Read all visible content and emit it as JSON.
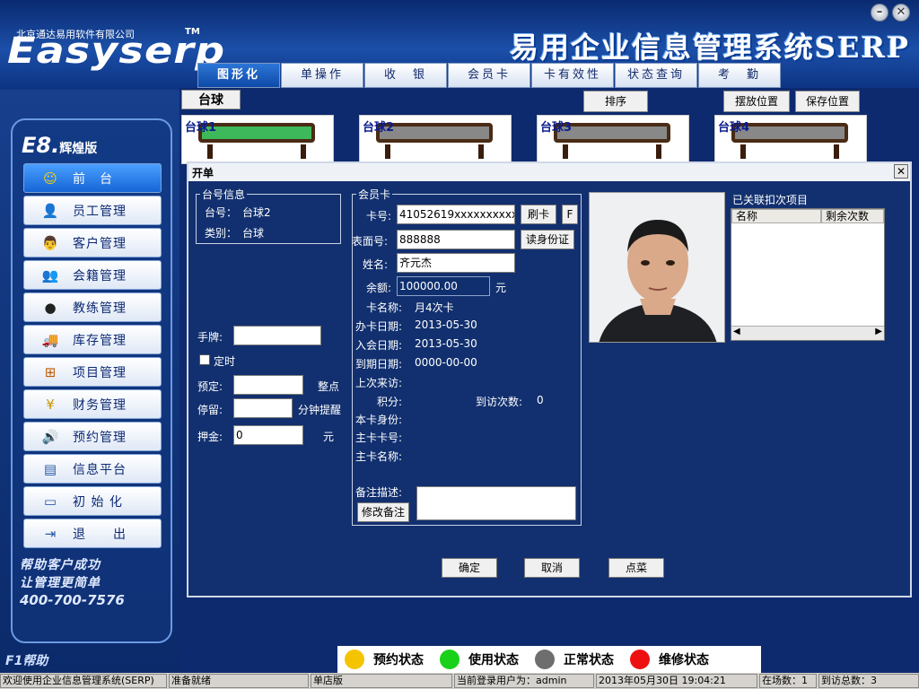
{
  "header": {
    "company": "北京通达易用软件有限公司",
    "logo": "Easyserp",
    "tm": "TM",
    "system_title": "易用企业信息管理系统SERP",
    "min_label": "–",
    "close_label": "✕"
  },
  "tabs": [
    "图形化",
    "单操作",
    "收　银",
    "会员卡",
    "卡有效性",
    "状态查询",
    "考　勤"
  ],
  "sidebar": {
    "edition_main": "E8.",
    "edition_sub": "辉煌版",
    "items": [
      {
        "label": "前　台",
        "icon": "smiley-icon",
        "glyph": "☺"
      },
      {
        "label": "员工管理",
        "icon": "user-icon",
        "glyph": "👤"
      },
      {
        "label": "客户管理",
        "icon": "customer-icon",
        "glyph": "👨"
      },
      {
        "label": "会籍管理",
        "icon": "membership-icon",
        "glyph": "👥"
      },
      {
        "label": "教练管理",
        "icon": "coach-icon",
        "glyph": "●"
      },
      {
        "label": "库存管理",
        "icon": "truck-icon",
        "glyph": "🚚"
      },
      {
        "label": "项目管理",
        "icon": "hierarchy-icon",
        "glyph": "⊞"
      },
      {
        "label": "财务管理",
        "icon": "coins-icon",
        "glyph": "¥"
      },
      {
        "label": "预约管理",
        "icon": "speaker-icon",
        "glyph": "🔊"
      },
      {
        "label": "信息平台",
        "icon": "info-platform-icon",
        "glyph": "▤"
      },
      {
        "label": "初 始 化",
        "icon": "monitor-icon",
        "glyph": "▭"
      },
      {
        "label": "退　　出",
        "icon": "exit-icon",
        "glyph": "⇥"
      }
    ],
    "slogan_line1": "帮助客户成功",
    "slogan_line2": "让管理更简单",
    "hotline": "400-700-7576",
    "help": "F1帮助"
  },
  "main": {
    "category": "台球",
    "sort_button": "排序",
    "place_button": "摆放位置",
    "save_button": "保存位置",
    "tables": [
      "台球1",
      "台球2",
      "台球3",
      "台球4"
    ]
  },
  "dialog": {
    "title": "开单",
    "close": "✕",
    "table_info": {
      "legend": "台号信息",
      "number_label": "台号：",
      "number_value": "台球2",
      "type_label": "类别：",
      "type_value": "台球"
    },
    "left_form": {
      "wristband_label": "手牌:",
      "wristband_value": "",
      "timer_label": "定时",
      "reserve_label": "预定:",
      "reserve_value": "",
      "reserve_unit": "整点",
      "stay_label": "停留:",
      "stay_value": "",
      "stay_unit": "分钟提醒",
      "deposit_label": "押金:",
      "deposit_value": "0",
      "deposit_unit": "元"
    },
    "member": {
      "legend": "会员卡",
      "card_no_label": "卡号:",
      "card_no_value": "41052619xxxxxxxxxx",
      "swipe_button": "刷卡",
      "f_button": "F",
      "face_no_label": "表面号:",
      "face_no_value": "888888",
      "read_id_button": "读身份证",
      "name_label": "姓名:",
      "name_value": "齐元杰",
      "balance_label": "余额:",
      "balance_value": "100000.00",
      "balance_unit": "元",
      "card_name_label": "卡名称:",
      "card_name_value": "月4次卡",
      "issue_date_label": "办卡日期:",
      "issue_date_value": "2013-05-30",
      "join_date_label": "入会日期:",
      "join_date_value": "2013-05-30",
      "expire_date_label": "到期日期:",
      "expire_date_value": "0000-00-00",
      "last_visit_label": "上次来访:",
      "points_label": "积分:",
      "visits_label": "到访次数:",
      "visits_value": "0",
      "card_identity_label": "本卡身份:",
      "main_card_no_label": "主卡卡号:",
      "main_card_name_label": "主卡名称:",
      "remark_label": "备注描述:",
      "remark_value": "",
      "edit_remark_button": "修改备注"
    },
    "linked": {
      "legend": "已关联扣次项目",
      "col_name": "名称",
      "col_remaining": "剩余次数"
    },
    "ok_button": "确定",
    "cancel_button": "取消",
    "order_button": "点菜"
  },
  "legend": [
    {
      "label": "预约状态",
      "color": "#f5c400"
    },
    {
      "label": "使用状态",
      "color": "#19d119"
    },
    {
      "label": "正常状态",
      "color": "#6e6e6e"
    },
    {
      "label": "维修状态",
      "color": "#ee1010"
    }
  ],
  "statusbar": {
    "welcome": "欢迎使用企业信息管理系统(SERP)",
    "ready": "准备就绪",
    "edition": "单店版",
    "user": "当前登录用户为：admin",
    "datetime": "2013年05月30日 19:04:21",
    "present": "在场数：1",
    "visits": "到访总数：3"
  }
}
